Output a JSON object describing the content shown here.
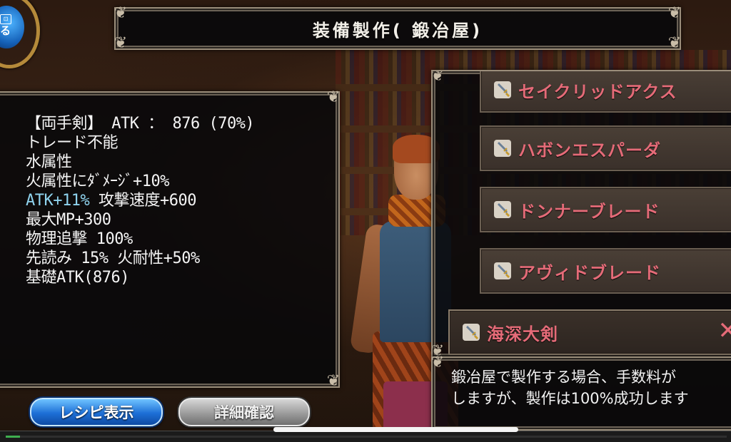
{
  "title": "装備製作( 鍛冶屋)",
  "globe_button": {
    "label": "る",
    "sub": "⊡"
  },
  "stats": {
    "lines": [
      "【両手剣】 ATK ： 876 (70%)",
      "トレード不能",
      "水属性",
      "火属性にﾀﾞﾒｰｼﾞ+10%",
      "ATK+11%",
      "最大MP+300",
      "物理追撃 100%",
      "先読み 15% 火耐性+50%",
      "基礎ATK(876)"
    ],
    "line5_rest": " 攻撃速度+600"
  },
  "recipes": {
    "items": [
      {
        "name": "セイクリッドアクス"
      },
      {
        "name": "ハボンエスパーダ"
      },
      {
        "name": "ドンナーブレード"
      },
      {
        "name": "アヴィドブレード"
      }
    ],
    "selected": {
      "name": "海深大剣",
      "close": "✕"
    }
  },
  "description": {
    "line1": "鍛冶屋で製作する場合、手数料が",
    "line2": "しますが、製作は100%成功します"
  },
  "buttons": {
    "recipe": "レシピ表示",
    "detail": "詳細確認"
  },
  "progress": {
    "fraction": 0.02
  },
  "colors": {
    "recipe_text": "#e56b78",
    "accent_text": "#8fd3ee",
    "progress": "#3fae4f"
  },
  "icons": {
    "recipe_item": "sword-icon",
    "globe": "globe-icon",
    "close": "close-icon"
  }
}
